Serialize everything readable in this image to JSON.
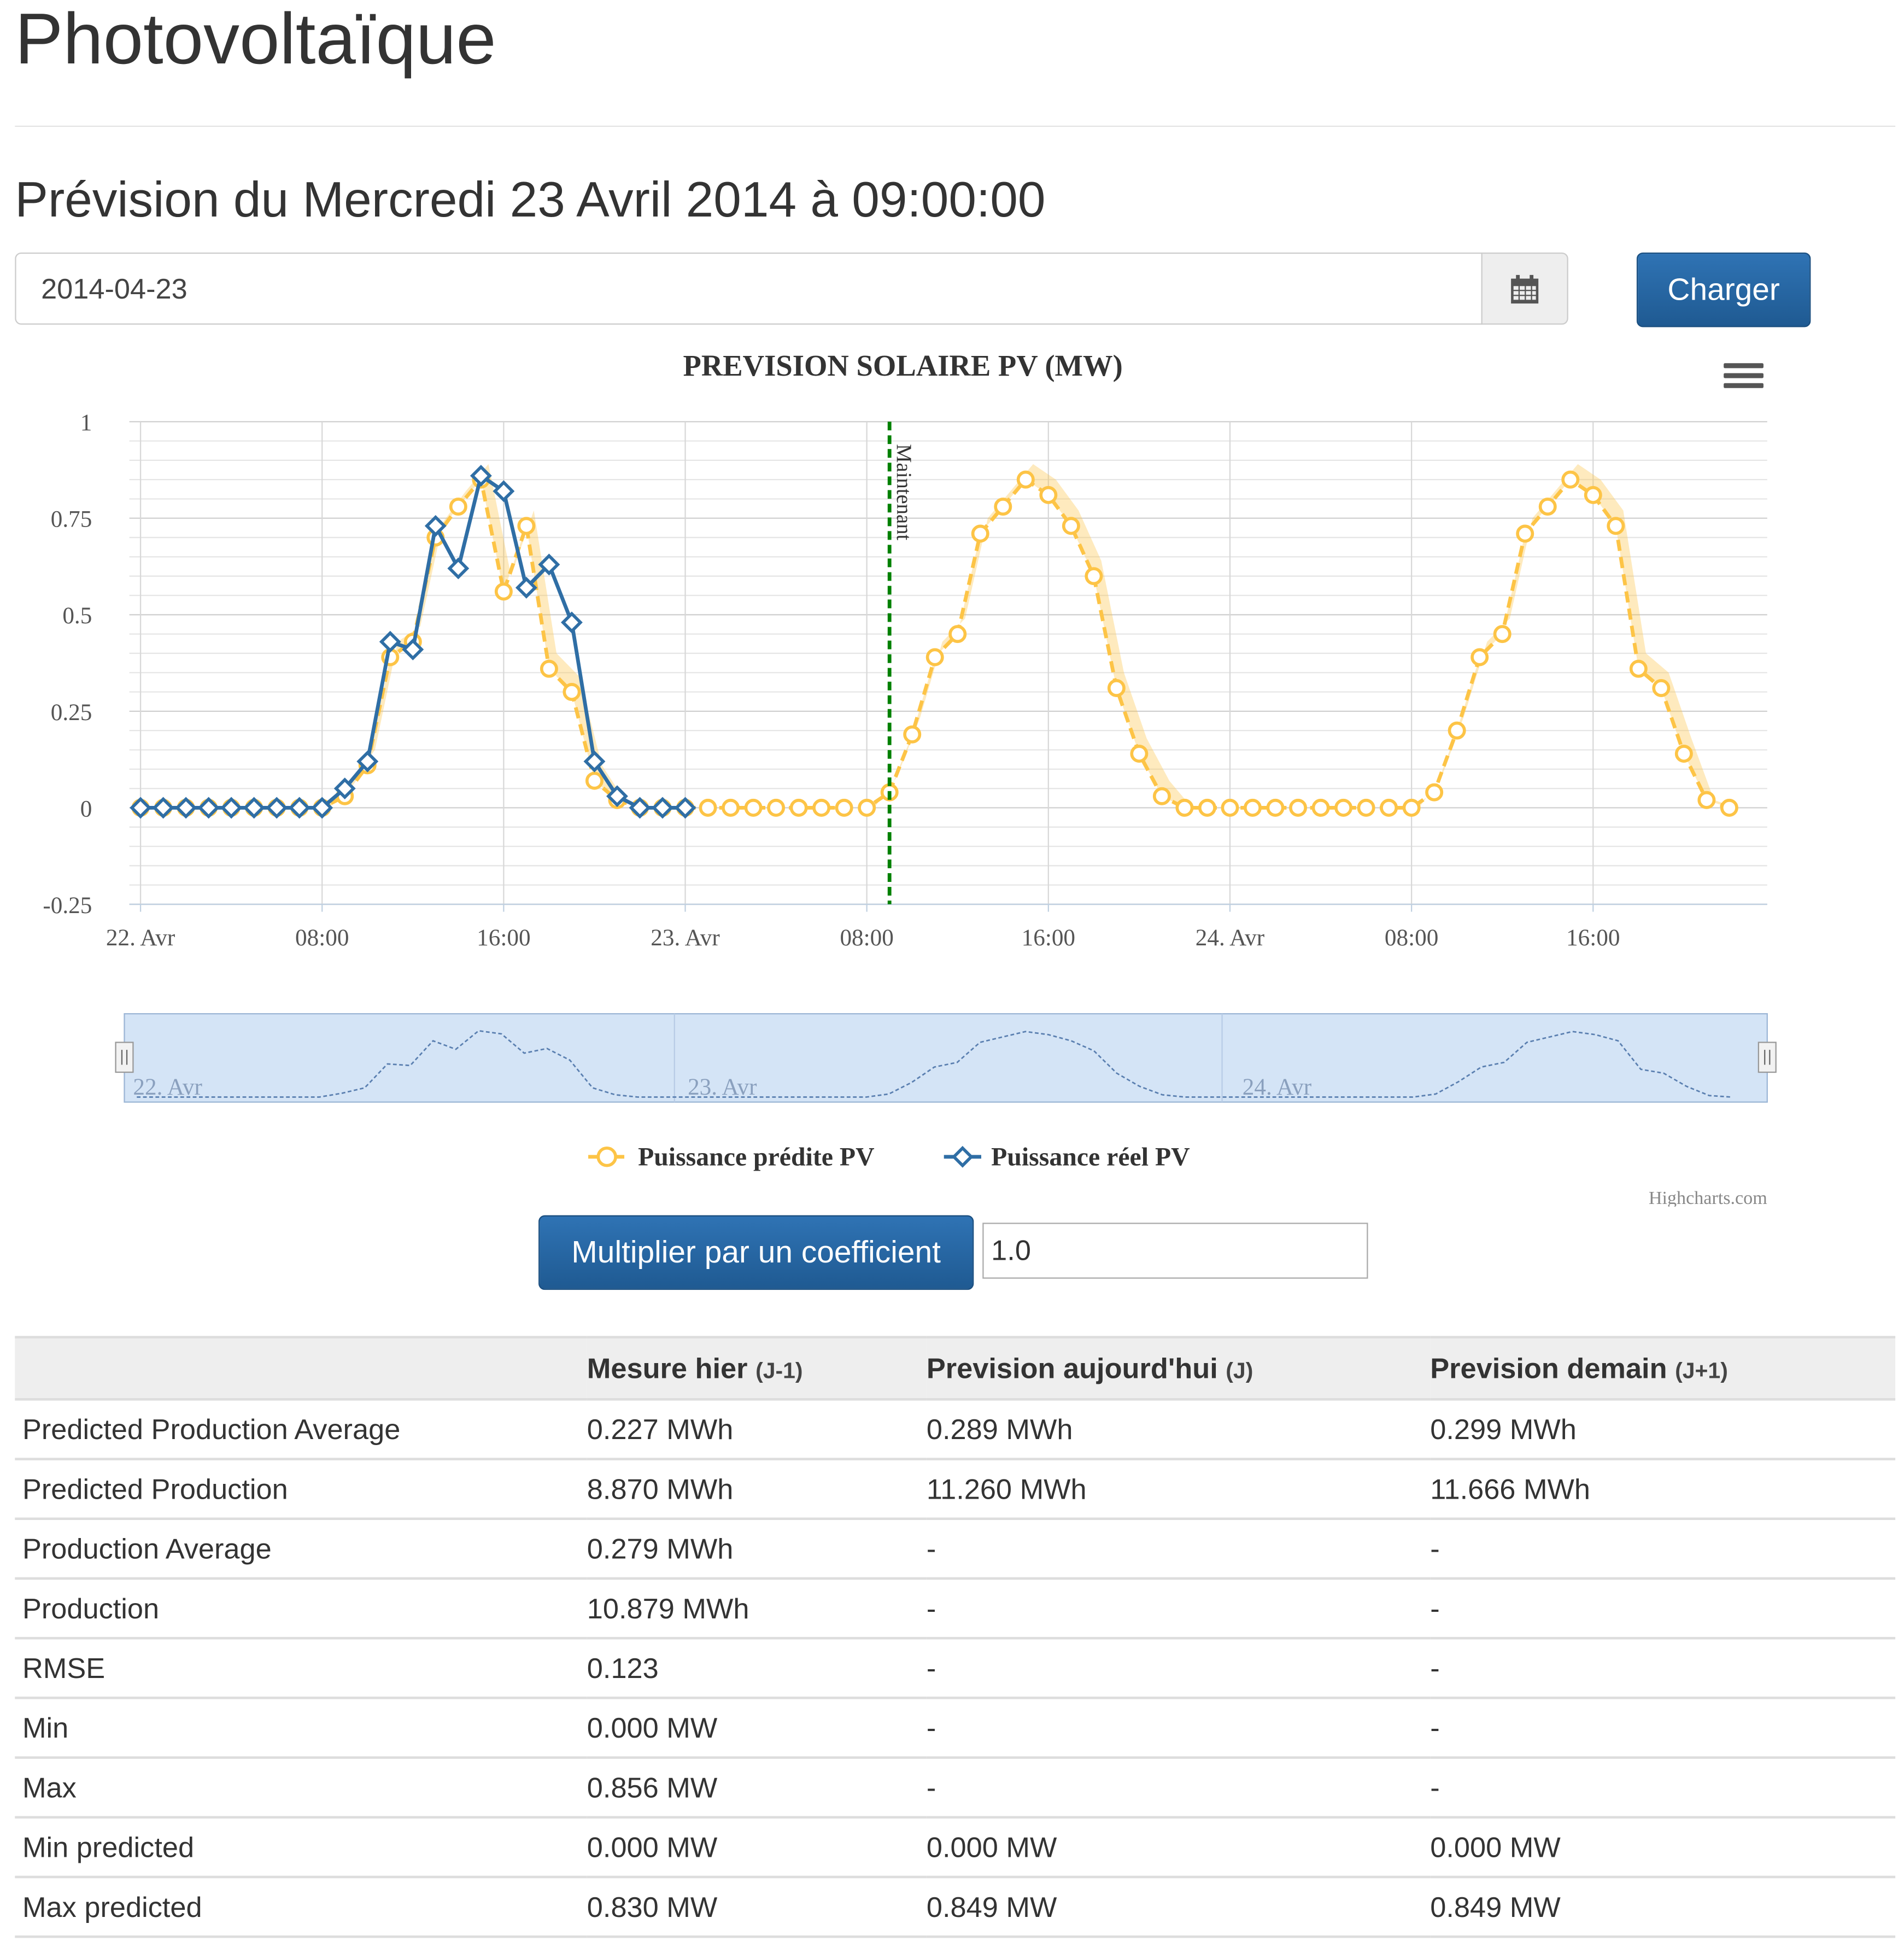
{
  "page": {
    "title": "Photovoltaïque",
    "forecast_title": "Prévision du Mercredi 23 Avril 2014 à 09:00:00"
  },
  "form": {
    "date_value": "2014-04-23",
    "calendar_icon": "calendar-icon",
    "load_label": "Charger",
    "multiply_label": "Multiplier par un coefficient",
    "coefficient_value": "1.0"
  },
  "colors": {
    "primary_button": "#1f5a92",
    "predicted": "#fdc446",
    "actual": "#2f6ea5",
    "now_line": "#008000"
  },
  "chart_data": {
    "type": "line",
    "title": "PREVISION SOLAIRE PV (MW)",
    "menu_icon": "hamburger-menu-icon",
    "x_ticks": [
      "22. Avr",
      "08:00",
      "16:00",
      "23. Avr",
      "08:00",
      "16:00",
      "24. Avr",
      "08:00",
      "16:00"
    ],
    "y_ticks": [
      "1",
      "0.75",
      "0.5",
      "0.25",
      "0",
      "-0.25"
    ],
    "ylim": [
      -0.25,
      1
    ],
    "xlim_hours": [
      0,
      71
    ],
    "plot_line_label": "Maintenant",
    "plot_line_hour": 33,
    "navigator_labels": [
      "22. Avr",
      "23. Avr",
      "24. Avr"
    ],
    "credits": "Highcharts.com",
    "series": [
      {
        "name": "Puissance prédite PV",
        "marker": "circle",
        "x_hours": [
          0,
          1,
          2,
          3,
          4,
          5,
          6,
          7,
          8,
          9,
          10,
          11,
          12,
          13,
          14,
          15,
          16,
          17,
          18,
          19,
          20,
          21,
          22,
          23,
          24,
          25,
          26,
          27,
          28,
          29,
          30,
          31,
          32,
          33,
          34,
          35,
          36,
          37,
          38,
          39,
          40,
          41,
          42,
          43,
          44,
          45,
          46,
          47,
          48,
          49,
          50,
          51,
          52,
          53,
          54,
          55,
          56,
          57,
          58,
          59,
          60,
          61,
          62,
          63,
          64,
          65,
          66,
          67,
          68,
          69,
          70
        ],
        "values": [
          0,
          0,
          0,
          0,
          0,
          0,
          0,
          0,
          0,
          0.03,
          0.11,
          0.39,
          0.43,
          0.7,
          0.78,
          0.85,
          0.56,
          0.73,
          0.36,
          0.3,
          0.07,
          0.02,
          0,
          0,
          0,
          0,
          0,
          0,
          0,
          0,
          0,
          0,
          0,
          0.04,
          0.19,
          0.39,
          0.45,
          0.71,
          0.78,
          0.85,
          0.81,
          0.73,
          0.6,
          0.31,
          0.14,
          0.03,
          0,
          0,
          0,
          0,
          0,
          0,
          0,
          0,
          0,
          0,
          0,
          0.04,
          0.2,
          0.39,
          0.45,
          0.71,
          0.78,
          0.85,
          0.81,
          0.73,
          0.36,
          0.31,
          0.14,
          0.02,
          0
        ]
      },
      {
        "name": "Puissance réel PV",
        "marker": "diamond",
        "x_hours": [
          0,
          1,
          2,
          3,
          4,
          5,
          6,
          7,
          8,
          9,
          10,
          11,
          12,
          13,
          14,
          15,
          16,
          17,
          18,
          19,
          20,
          21,
          22,
          23,
          24
        ],
        "values": [
          0,
          0,
          0,
          0,
          0,
          0,
          0,
          0,
          0,
          0.05,
          0.12,
          0.43,
          0.41,
          0.73,
          0.62,
          0.86,
          0.82,
          0.57,
          0.63,
          0.48,
          0.12,
          0.03,
          0,
          0,
          0
        ]
      }
    ]
  },
  "table": {
    "headers": [
      {
        "main": "",
        "sub": ""
      },
      {
        "main": "Mesure hier",
        "sub": "(J-1)"
      },
      {
        "main": "Prevision aujourd'hui",
        "sub": "(J)"
      },
      {
        "main": "Prevision demain",
        "sub": "(J+1)"
      }
    ],
    "rows": [
      [
        "Predicted Production Average",
        "0.227 MWh",
        "0.289 MWh",
        "0.299 MWh"
      ],
      [
        "Predicted Production",
        "8.870 MWh",
        "11.260 MWh",
        "11.666 MWh"
      ],
      [
        "Production Average",
        "0.279 MWh",
        "-",
        "-"
      ],
      [
        "Production",
        "10.879 MWh",
        "-",
        "-"
      ],
      [
        "RMSE",
        "0.123",
        "-",
        "-"
      ],
      [
        "Min",
        "0.000 MW",
        "-",
        "-"
      ],
      [
        "Max",
        "0.856 MW",
        "-",
        "-"
      ],
      [
        "Min predicted",
        "0.000 MW",
        "0.000 MW",
        "0.000 MW"
      ],
      [
        "Max predicted",
        "0.830 MW",
        "0.849 MW",
        "0.849 MW"
      ]
    ]
  }
}
